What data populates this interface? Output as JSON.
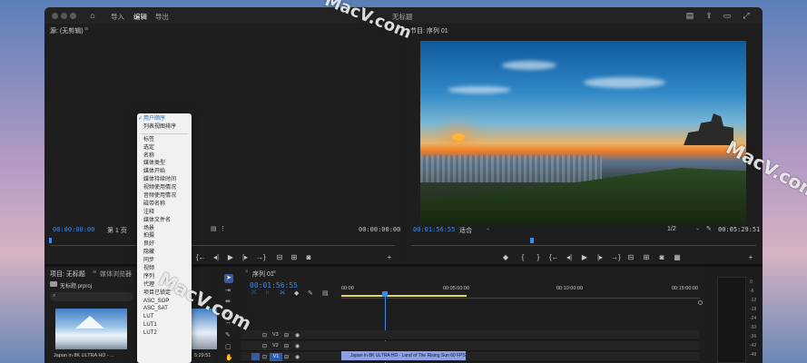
{
  "workspaces": [
    "导入",
    "编辑",
    "导出"
  ],
  "active_workspace": "编辑",
  "window_title": "无标题",
  "source_panel": {
    "title": "源: (无剪辑)",
    "timecode_left": "00:00:00:00",
    "page": "第 1 页",
    "timecode_right": "00:00:00:00"
  },
  "program_panel": {
    "title": "节目: 序列 01",
    "timecode_left": "00:01:56:55",
    "fit": "适合",
    "ratio": "1/2",
    "timecode_right": "00:05:29:51"
  },
  "context_menu": {
    "items": [
      "用户顺序",
      "列表视图排序",
      "标签",
      "选定",
      "名称",
      "媒体类型",
      "媒体开始",
      "媒体持续时间",
      "视频使用情况",
      "音频使用情况",
      "磁带名称",
      "注释",
      "媒体文件名",
      "场景",
      "拍摄",
      "良好",
      "隐藏",
      "同步",
      "视频",
      "序列",
      "代理",
      "项目已锁定",
      "ASC_SOP",
      "ASC_SAT",
      "LUT",
      "LUT1",
      "LUT2"
    ],
    "selected": "用户顺序"
  },
  "project_panel": {
    "tab_project": "项目: 无标题",
    "tab_browser": "媒体浏览器",
    "file": "无标题.prproj",
    "thumb_label": "Japan in 8K ULTRA HD - ...",
    "thumb_duration": "5:29:51"
  },
  "timeline": {
    "tab": "序列 01",
    "timecode": "00:01:56:55",
    "ruler_labels": [
      "00:00",
      "00:05:00:00",
      "00:10:00:00",
      "00:15:00:00"
    ],
    "tracks": [
      "V3",
      "V2",
      "V1"
    ],
    "clip_label": "Japan in 8K ULTRA HD - Land of The Rising Sun 60 FPS.mp4 [V]"
  },
  "meter_scale": [
    "0",
    "-6",
    "-12",
    "-18",
    "-24",
    "-30",
    "-36",
    "-42",
    "-48"
  ],
  "watermark": "MacV.com",
  "icons": {
    "home": "home-icon",
    "search": "search-icon",
    "close": "close-icon",
    "play": "play-icon",
    "camera": "camera-icon",
    "wrench": "wrench-icon",
    "share": "share-icon",
    "fullscreen": "fullscreen-icon"
  },
  "colors": {
    "accent": "#3a8bf0",
    "clip": "#8ea0e6",
    "panel": "#1e1e1e"
  }
}
